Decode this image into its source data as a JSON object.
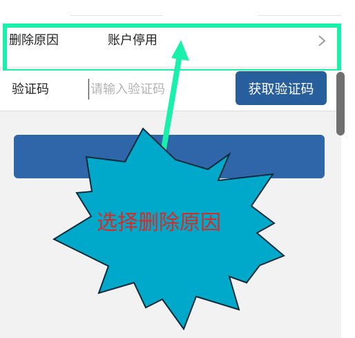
{
  "reason_row": {
    "label": "删除原因",
    "value": "账户停用"
  },
  "verification": {
    "label": "验证码",
    "placeholder": "请输入验证码",
    "button_label": "获取验证码"
  },
  "annotation": {
    "callout_text": "选择删除原因",
    "frame_color": "#19f0a9",
    "arrow_color": "#19f0a9",
    "burst_color": "#00a8ca",
    "text_color": "#d92b26"
  },
  "colors": {
    "primary_button": "#275e9c",
    "page_background": "#f2f2f2"
  }
}
